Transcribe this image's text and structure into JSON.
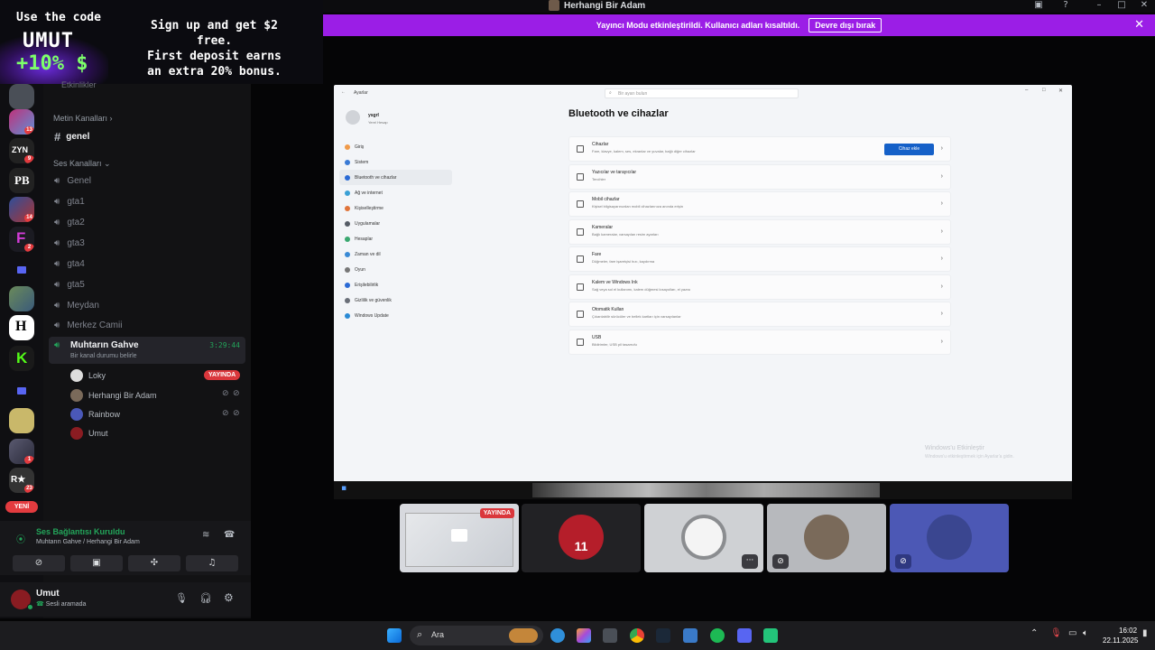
{
  "promo": {
    "code_line": "Use the code",
    "code": "UMUT",
    "bonus": "+10%",
    "currency_icon": "dollar-icon",
    "pitch_1": "Sign up and get $2 free.",
    "pitch_2": "First deposit earns",
    "pitch_3": "an extra 20% bonus."
  },
  "window": {
    "title": "Herhangi Bir Adam"
  },
  "banner": {
    "message": "Yayıncı Modu etkinleştirildi. Kullanıcı adları kısaltıldı.",
    "disable_label": "Devre dışı bırak",
    "color": "#9b1ee6"
  },
  "rail": {
    "badges": [
      "13",
      "9",
      "14",
      "2",
      "1",
      "23",
      "2"
    ],
    "new_label": "YENİ"
  },
  "channels": {
    "partial_top": "Etkinlikler",
    "text_category": "Metin Kanalları",
    "text_channels": [
      "genel"
    ],
    "voice_category": "Ses Kanalları",
    "voice_channels": [
      "Genel",
      "gta1",
      "gta2",
      "gta3",
      "gta4",
      "gta5",
      "Meydan",
      "Merkez Camii"
    ],
    "active": {
      "name": "Muhtarın Gahve",
      "timer": "3:29:44",
      "status_hint": "Bir kanal durumu belirle"
    },
    "members": [
      {
        "name": "Loky",
        "live": "YAYINDA"
      },
      {
        "name": "Herhangi Bir Adam"
      },
      {
        "name": "Rainbow"
      },
      {
        "name": "Umut"
      }
    ]
  },
  "voice": {
    "status": "Ses Bağlantısı Kuruldu",
    "location": "Muhtarın Gahve / Herhangi Bir Adam"
  },
  "user": {
    "name": "Umut",
    "status": "Sesli aramada"
  },
  "stream": {
    "app_title": "Ayarlar",
    "search_placeholder": "Bir ayarı bulun",
    "profile_name": "ysgrl",
    "profile_sub": "Yerel Hesap",
    "page_title": "Bluetooth ve cihazlar",
    "nav": [
      "Giriş",
      "Sistem",
      "Bluetooth ve cihazlar",
      "Ağ ve internet",
      "Kişiselleştirme",
      "Uygulamalar",
      "Hesaplar",
      "Zaman ve dil",
      "Oyun",
      "Erişilebilirlik",
      "Gizlilik ve güvenlik",
      "Windows Update"
    ],
    "add_device": "Cihaz ekle",
    "rows": [
      {
        "title": "Cihazlar",
        "sub": "Fare, klavye, kalem, ses, ekranlar ve yuvalar, bağlı diğer cihazlar"
      },
      {
        "title": "Yazıcılar ve tarayıcılar",
        "sub": "Tercihler"
      },
      {
        "title": "Mobil cihazlar",
        "sub": "Kişisel bilgisayarınızdan mobil cihazlarınıza anında erişin"
      },
      {
        "title": "Kameralar",
        "sub": "Bağlı kameralar, varsayılan resim ayarları"
      },
      {
        "title": "Fare",
        "sub": "Düğmeler, fare işaretçisi hızı, kaydırma"
      },
      {
        "title": "Kalem ve Windows Ink",
        "sub": "Sağ veya sol el kullanımı, kalem düğmesi kısayolları, el yazısı"
      },
      {
        "title": "Otomatik Kullan",
        "sub": "Çıkarılabilir sürücüler ve bellek kartları için varsayılanlar"
      },
      {
        "title": "USB",
        "sub": "Bildirimler, USB pil tasarrufu"
      }
    ],
    "watermark_1": "Windows'u Etkinleştir",
    "watermark_2": "Windows'u etkinleştirmek için Ayarlar'a gidin."
  },
  "tiles": {
    "live_label": "YAYINDA",
    "jersey": "11"
  },
  "taskbar": {
    "search": "Ara",
    "time": "16:02",
    "date": "22.11.2025"
  }
}
